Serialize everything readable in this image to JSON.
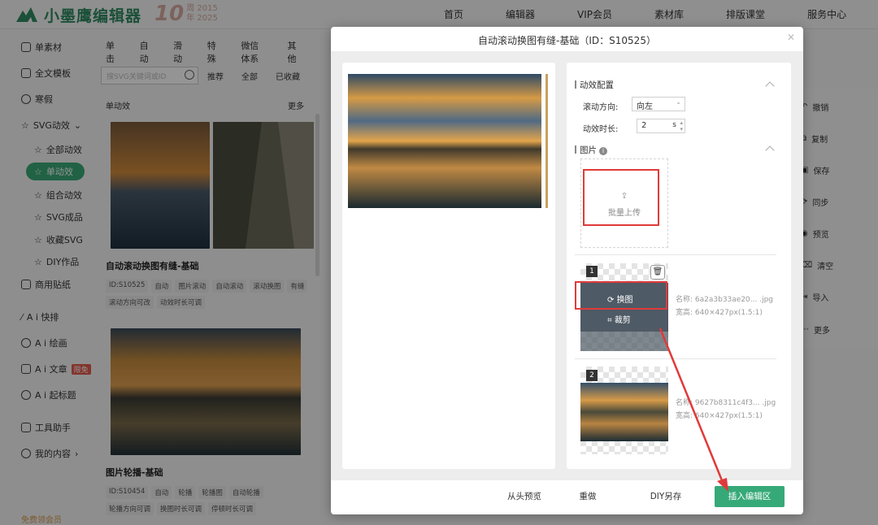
{
  "brand": {
    "name": "小墨鹰编辑器",
    "anniv_num": "10",
    "anniv_y1": "周 2015",
    "anniv_y2": "年 2025"
  },
  "topnav": [
    "首页",
    "编辑器",
    "VIP会员",
    "素材库",
    "排版课堂",
    "服务中心"
  ],
  "sidebar": {
    "items": [
      {
        "label": "单素材"
      },
      {
        "label": "全文模板"
      },
      {
        "label": "寒假"
      },
      {
        "label": "SVG动效"
      },
      {
        "label": "全部动效"
      },
      {
        "label": "单动效"
      },
      {
        "label": "组合动效"
      },
      {
        "label": "SVG成品"
      },
      {
        "label": "收藏SVG"
      },
      {
        "label": "DIY作品"
      },
      {
        "label": "商用贴纸"
      },
      {
        "label": "A i 快排"
      },
      {
        "label": "A i 绘画"
      },
      {
        "label": "A i 文章"
      },
      {
        "label": "A i 起标题"
      },
      {
        "label": "工具助手"
      },
      {
        "label": "我的内容"
      }
    ],
    "ai_badge": "限免",
    "promo": "免费领会员"
  },
  "content": {
    "cat_tabs": [
      "单击",
      "自动",
      "滑动",
      "特殊",
      "微信体系",
      "其他"
    ],
    "search_placeholder": "搜SVG关键词或ID",
    "filters": [
      "推荐",
      "全部",
      "已收藏"
    ],
    "section_title": "单动效",
    "section_more": "更多",
    "cards": [
      {
        "title": "自动滚动换图有缝-基础",
        "tags": [
          "ID:S10525",
          "自动",
          "图片滚动",
          "自动滚动",
          "滚动换图",
          "有缝",
          "滚动方向可改",
          "动效时长可调"
        ]
      },
      {
        "title": "图片轮播-基础",
        "tags": [
          "ID:S10454",
          "自动",
          "轮播",
          "轮播图",
          "自动轮播",
          "轮播方向可调",
          "换图时长可调",
          "停顿时长可调"
        ]
      }
    ]
  },
  "right_tools": [
    "撤销",
    "复制",
    "保存",
    "同步",
    "预览",
    "清空",
    "导入",
    "更多"
  ],
  "modal": {
    "title": "自动滚动换图有缝-基础（ID：S10525）",
    "close_icon": "close-icon",
    "effect_config": "动效配置",
    "direction_label": "滚动方向:",
    "direction_value": "向左",
    "duration_label": "动效时长:",
    "duration_value": "2",
    "duration_unit": "s",
    "images_label": "图片",
    "upload_label": "批量上传",
    "images": [
      {
        "num": "1",
        "name": "名称: 6a2a3b33ae20... .jpg",
        "size": "宽高: 640×427px(1.5:1)"
      },
      {
        "num": "2",
        "name": "名称: 9627b8311c4f3... .jpg",
        "size": "宽高: 640×427px(1.5:1)"
      }
    ],
    "replace_label": "换图",
    "crop_label": "裁剪",
    "footer": {
      "preview": "从头预览",
      "redo": "重做",
      "diy_save": "DIY另存",
      "insert": "插入编辑区"
    }
  },
  "colors": {
    "accent": "#36a978",
    "highlight": "#e03a3a",
    "brand": "#2f8a62"
  }
}
